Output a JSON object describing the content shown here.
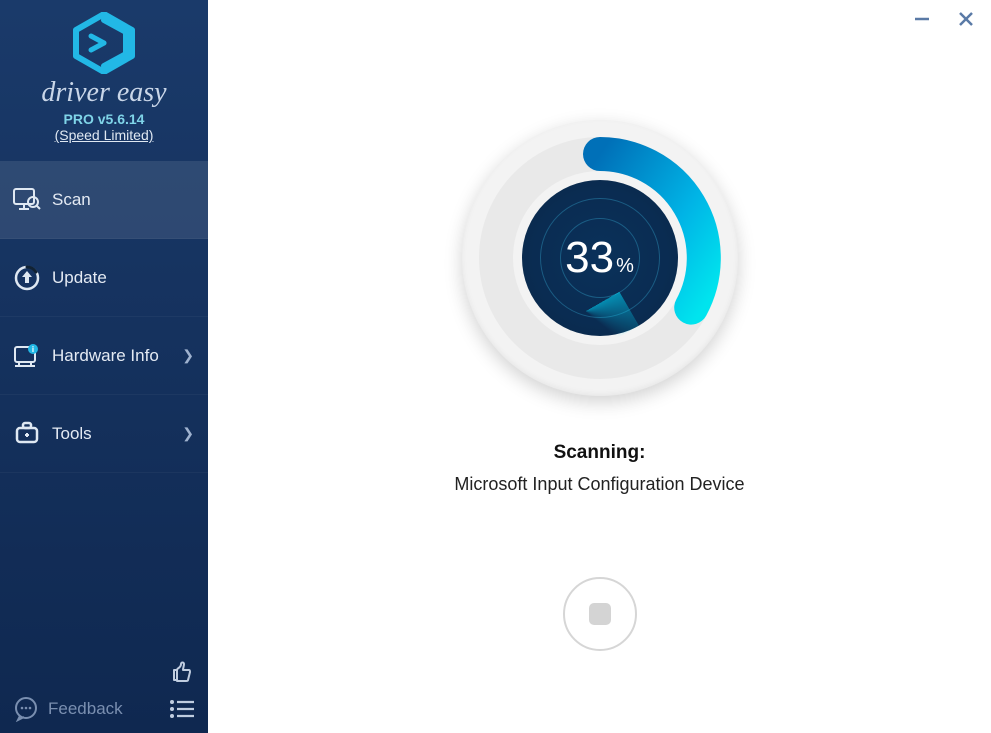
{
  "app": {
    "brand": "driver easy",
    "version": "PRO v5.6.14",
    "speed_limited": "(Speed Limited)"
  },
  "nav": {
    "scan": "Scan",
    "update": "Update",
    "hardware_info": "Hardware Info",
    "tools": "Tools"
  },
  "footer": {
    "feedback": "Feedback"
  },
  "scan": {
    "percent": "33",
    "percent_symbol": "%",
    "status_title": "Scanning:",
    "status_detail": "Microsoft Input Configuration Device"
  },
  "colors": {
    "sidebar_bg": "#133159",
    "accent_cyan": "#00c4e8",
    "accent_blue": "#0577bf"
  }
}
